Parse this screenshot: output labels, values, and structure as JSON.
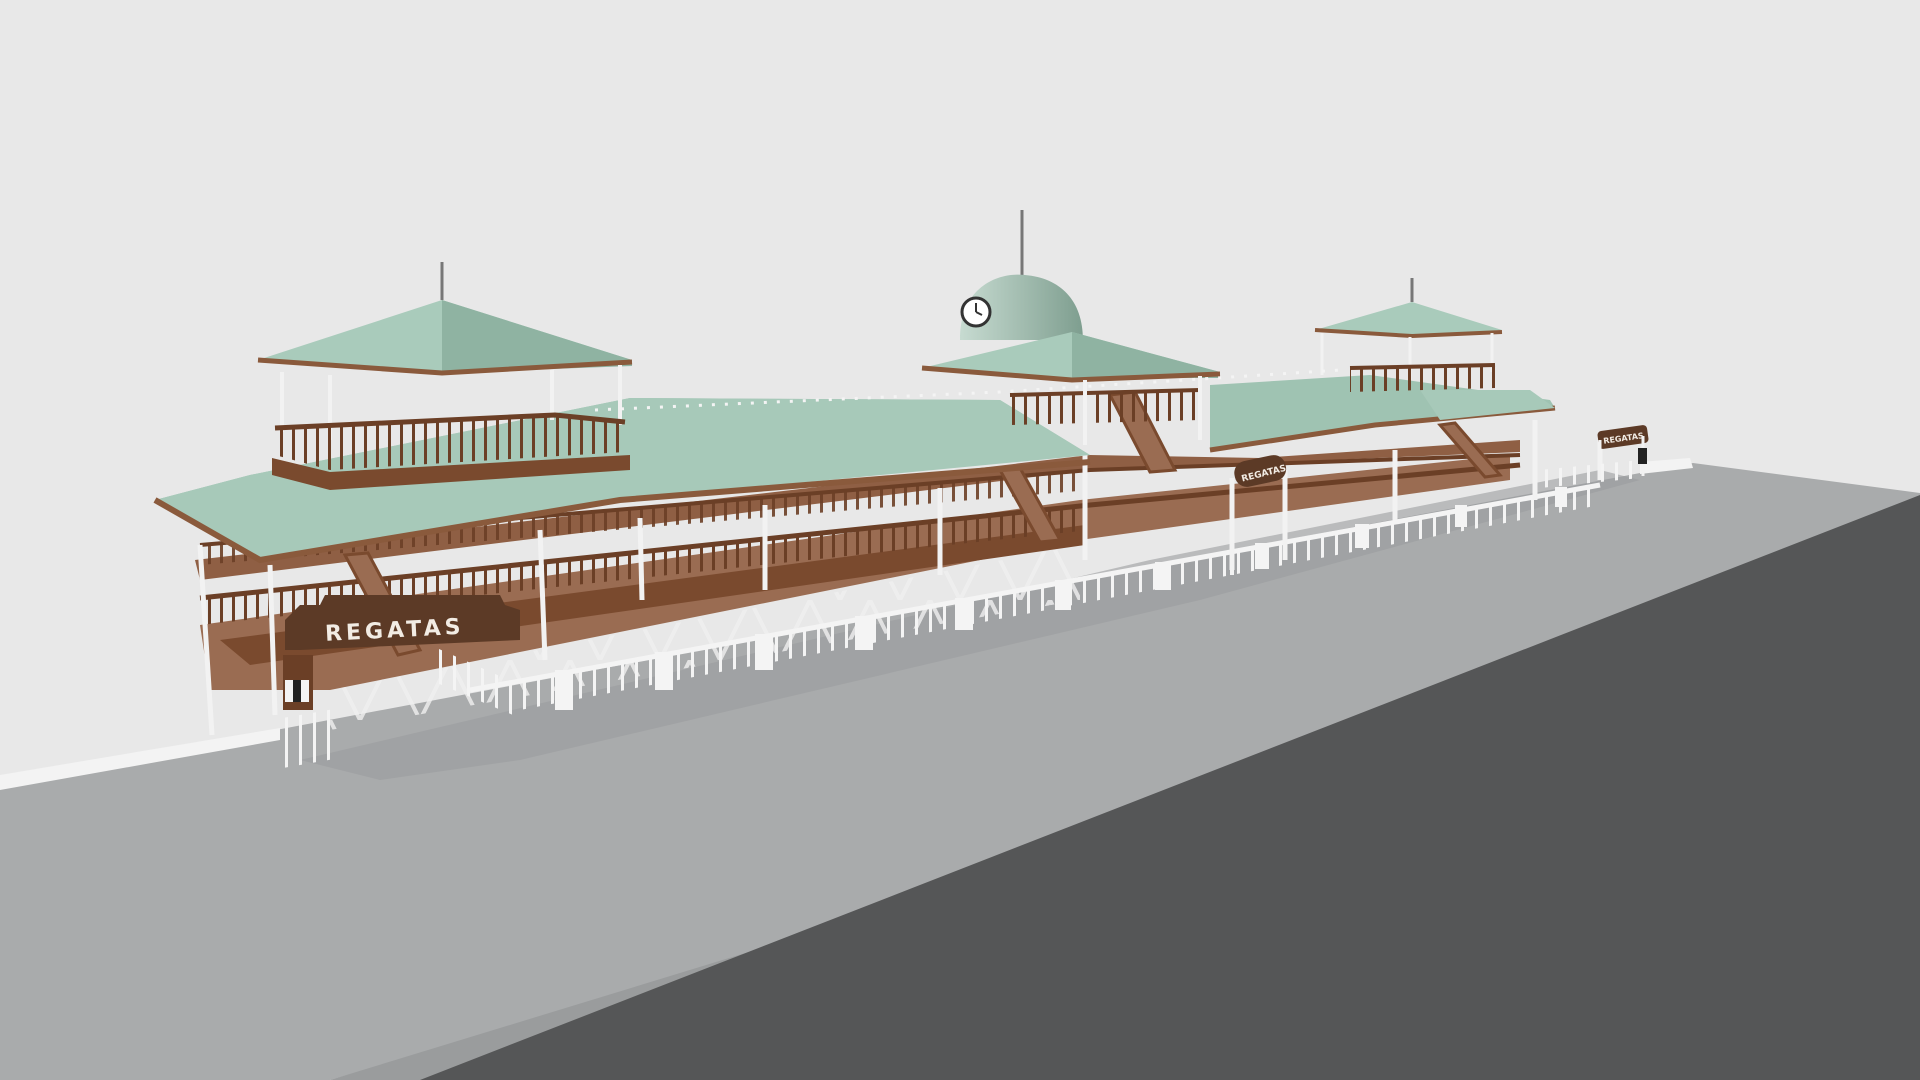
{
  "scene": {
    "subject": "3D model of a covered boat-race grandstand on a raised concrete platform",
    "background": "#e8e8e8"
  },
  "signs": {
    "main": "REGATAS",
    "middle": "REGATAS",
    "far": "REGATAS"
  },
  "colors": {
    "roof": "#9fc3b2",
    "roof_shade": "#86ab9a",
    "roof_edge": "#8a5a3c",
    "wood": "#7a4a2e",
    "deck": "#9a6c52",
    "railing_white": "#f4f4f4",
    "platform_top": "#a9abac",
    "platform_side": "#555657",
    "sign_bg": "#5c3a26"
  }
}
